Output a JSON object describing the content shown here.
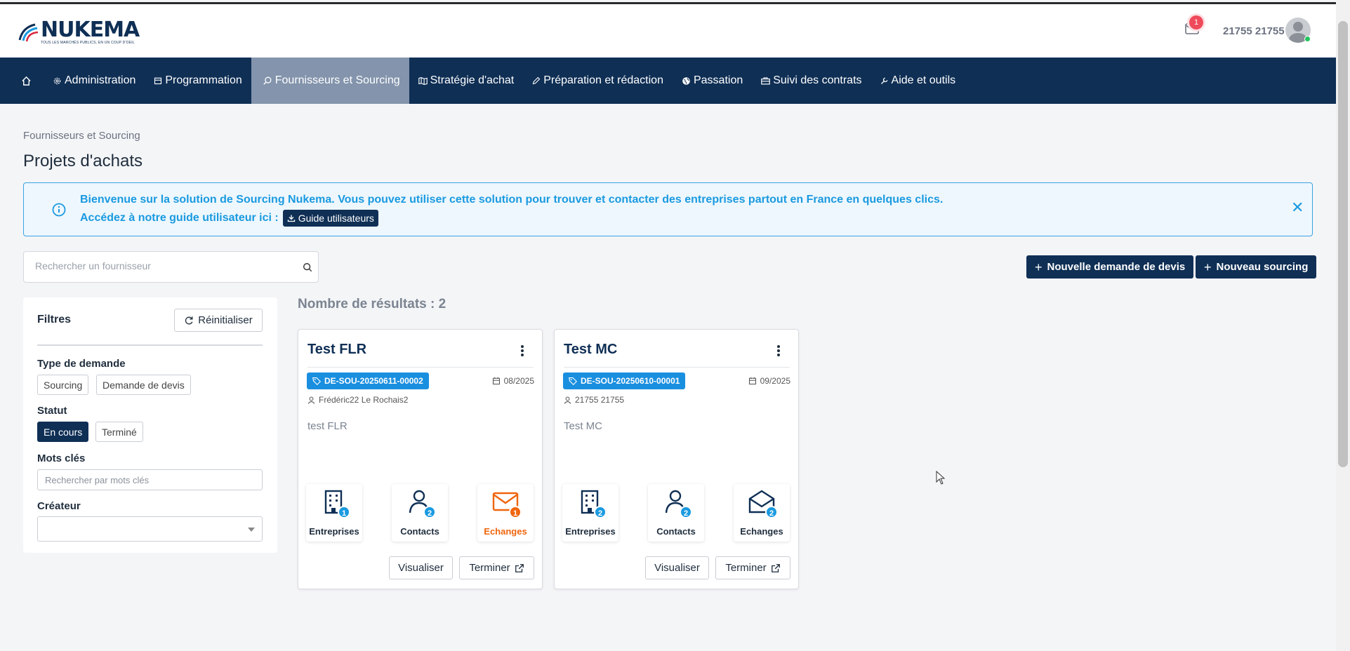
{
  "header": {
    "logo_text": "NUKEMA",
    "logo_tagline": "TOUS LES MARCHÉS PUBLICS, EN UN COUP D'OEIL",
    "notification_count": "1",
    "user_name": "21755 21755"
  },
  "nav": {
    "items": [
      {
        "label": "Administration",
        "icon": "gear-icon"
      },
      {
        "label": "Programmation",
        "icon": "calendar-icon"
      },
      {
        "label": "Fournisseurs et Sourcing",
        "icon": "search-icon"
      },
      {
        "label": "Stratégie d'achat",
        "icon": "map-icon"
      },
      {
        "label": "Préparation et rédaction",
        "icon": "pencil-icon"
      },
      {
        "label": "Passation",
        "icon": "globe-icon"
      },
      {
        "label": "Suivi des contrats",
        "icon": "briefcase-icon"
      },
      {
        "label": "Aide et outils",
        "icon": "wrench-icon"
      }
    ],
    "active": "Fournisseurs et Sourcing"
  },
  "page": {
    "breadcrumb": "Fournisseurs et Sourcing",
    "title": "Projets d'achats"
  },
  "alert": {
    "line1": "Bienvenue sur la solution de Sourcing Nukema. Vous pouvez utiliser cette solution pour trouver et contacter des entreprises partout en France en quelques clics.",
    "line2": "Accédez à notre guide utilisateur ici :",
    "guide_button": "Guide utilisateurs"
  },
  "search": {
    "placeholder": "Rechercher un fournisseur"
  },
  "actions": {
    "new_quote_request": "Nouvelle demande de devis",
    "new_sourcing": "Nouveau sourcing"
  },
  "filters": {
    "title": "Filtres",
    "reset": "Réinitialiser",
    "type_label": "Type de demande",
    "type_options": [
      "Sourcing",
      "Demande de devis"
    ],
    "status_label": "Statut",
    "status_options": [
      "En cours",
      "Terminé"
    ],
    "status_selected": "En cours",
    "keywords_label": "Mots clés",
    "keywords_placeholder": "Rechercher par mots clés",
    "creator_label": "Créateur",
    "creator_value": ""
  },
  "results": {
    "count_label": "Nombre de résultats : 2"
  },
  "cards": [
    {
      "title": "Test FLR",
      "reference": "DE-SOU-20250611-00002",
      "date": "08/2025",
      "creator": "Frédéric22 Le Rochais2",
      "description": "test FLR",
      "tiles": [
        {
          "label": "Entreprises",
          "count": "1"
        },
        {
          "label": "Contacts",
          "count": "2"
        },
        {
          "label": "Echanges",
          "count": "1",
          "highlight": "#f0650e"
        }
      ],
      "view_button": "Visualiser",
      "finish_button": "Terminer"
    },
    {
      "title": "Test MC",
      "reference": "DE-SOU-20250610-00001",
      "date": "09/2025",
      "creator": "21755 21755",
      "description": "Test MC",
      "tiles": [
        {
          "label": "Entreprises",
          "count": "2"
        },
        {
          "label": "Contacts",
          "count": "2"
        },
        {
          "label": "Echanges",
          "count": "2"
        }
      ],
      "view_button": "Visualiser",
      "finish_button": "Terminer"
    }
  ],
  "colors": {
    "navy": "#0f2f55",
    "accent_blue": "#1a9ae0",
    "orange": "#f0650e",
    "nav_active": "#8394ac"
  }
}
